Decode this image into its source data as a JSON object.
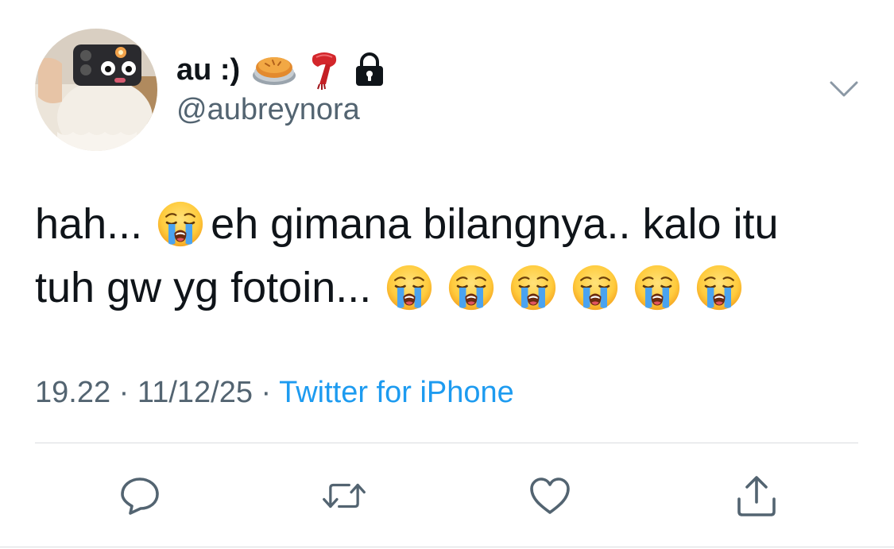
{
  "author": {
    "display_name": "au :)",
    "handle": "@aubreynora",
    "name_emojis": [
      "pie-emoji",
      "scarf-emoji"
    ],
    "protected_icon": "lock-icon"
  },
  "tweet": {
    "line1_a": "hah...",
    "line1_b": "eh gimana bilangnya.. kalo itu",
    "line2": "tuh gw yg fotoin...",
    "emoji": "loudly-crying-face-emoji",
    "trailing_emoji_count": 6
  },
  "meta": {
    "time": "19.22",
    "separator": " · ",
    "date": "11/12/25",
    "source": "Twitter for iPhone"
  },
  "actions": [
    "reply-icon",
    "retweet-icon",
    "like-icon",
    "share-icon"
  ],
  "colors": {
    "text": "#0f1419",
    "secondary": "#536471",
    "link": "#1d9bf0",
    "divider": "#d9dcdf"
  }
}
